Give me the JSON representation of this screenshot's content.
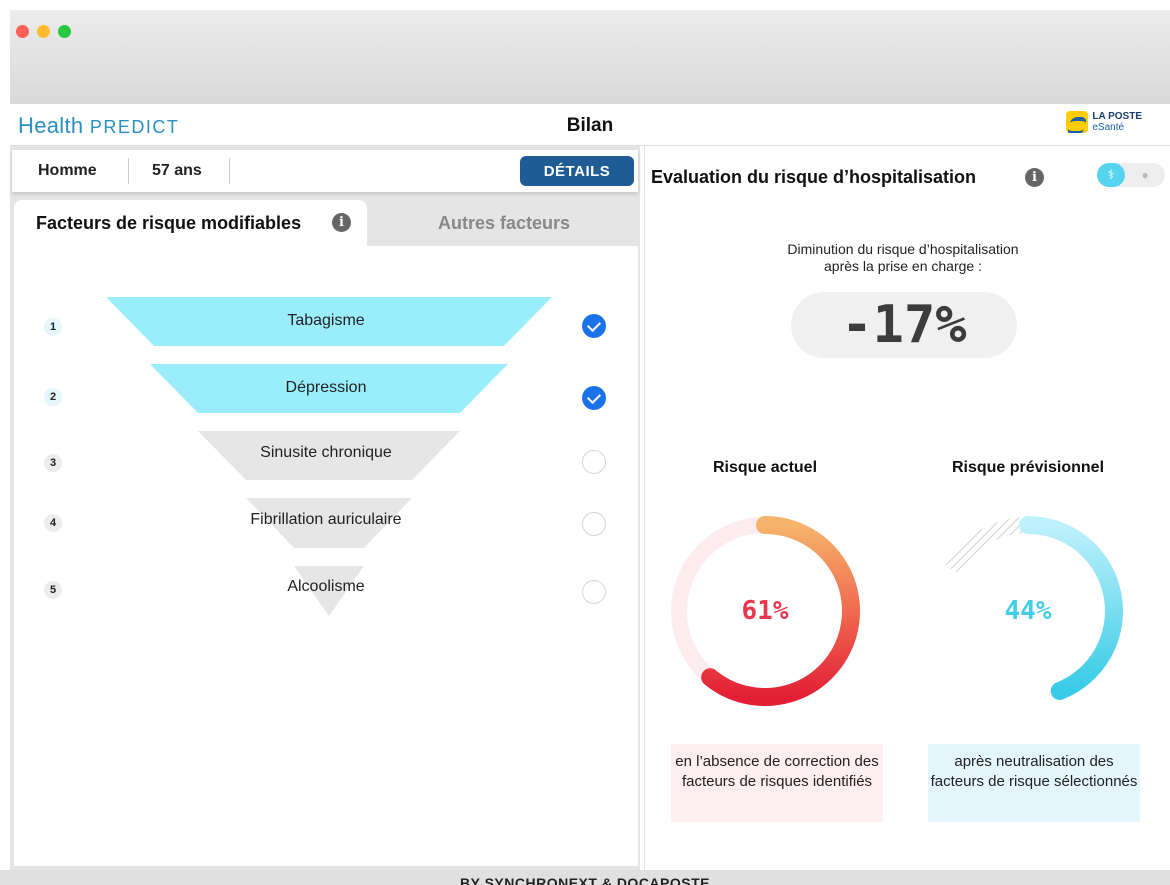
{
  "app": {
    "brand_main": "Health",
    "brand_sub": "PREDICT",
    "title": "Bilan",
    "partner_line1": "LA POSTE",
    "partner_line2": "eSanté",
    "footer": "BY SYNCHRONEXT & DOCAPOSTE"
  },
  "patient": {
    "sex": "Homme",
    "age": "57 ans",
    "details_label": "DÉTAILS"
  },
  "tabs": [
    {
      "label": "Facteurs de risque modifiables",
      "active": true
    },
    {
      "label": "Autres facteurs",
      "active": false
    }
  ],
  "factors": [
    {
      "rank": "1",
      "label": "Tabagisme",
      "selected": true
    },
    {
      "rank": "2",
      "label": "Dépression",
      "selected": true
    },
    {
      "rank": "3",
      "label": "Sinusite chronique",
      "selected": false
    },
    {
      "rank": "4",
      "label": "Fibrillation auriculaire",
      "selected": false
    },
    {
      "rank": "5",
      "label": "Alcoolisme",
      "selected": false
    }
  ],
  "evaluation": {
    "title": "Evaluation du risque d’hospitalisation",
    "reduction_caption_line1": "Diminution du risque d’hospitalisation",
    "reduction_caption_line2": "après la prise en charge :",
    "reduction_value": "-17%",
    "current": {
      "title": "Risque actuel",
      "value_label": "61%",
      "value": 0.61,
      "caption": "en l’absence de correction des facteurs de risques identifiés"
    },
    "forecast": {
      "title": "Risque prévisionnel",
      "value_label": "44%",
      "value": 0.44,
      "caption": "après neutralisation des facteurs de risque sélectionnés"
    }
  },
  "colors": {
    "accent_blue": "#1f5c95",
    "selected_segment": "#9aeefb",
    "unselected_segment": "#e6e6e6",
    "risk_red": "#e8384f",
    "risk_orange": "#f6b46a",
    "forecast_cyan": "#42cde8",
    "brand": "#2a8fc1"
  },
  "icons": {
    "info": "info-icon",
    "check": "check-icon",
    "doctor": "stethoscope-icon",
    "patient": "user-icon"
  }
}
